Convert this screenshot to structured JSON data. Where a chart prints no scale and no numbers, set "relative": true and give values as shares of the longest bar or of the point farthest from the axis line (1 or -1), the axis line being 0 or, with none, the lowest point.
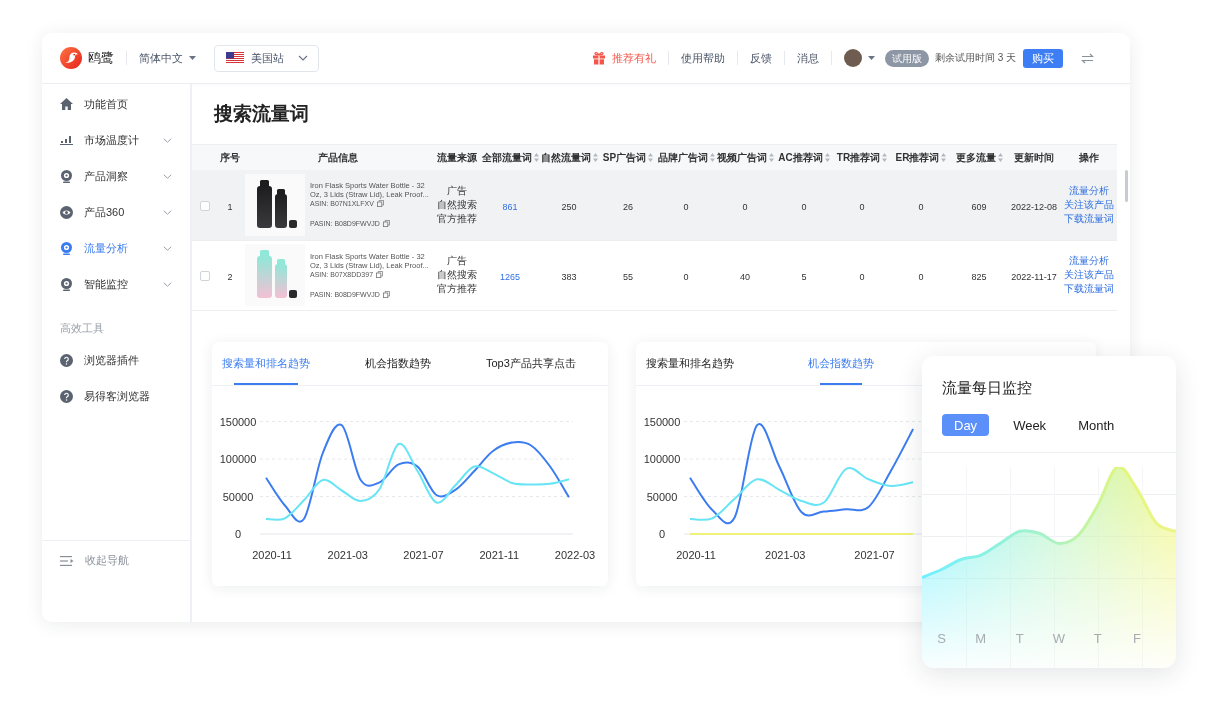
{
  "header": {
    "logo_text": "鸥鹭",
    "language": "简体中文",
    "region": "美国站",
    "links": [
      {
        "label": "推荐有礼",
        "kind": "promo"
      },
      {
        "label": "使用帮助",
        "kind": "plain"
      },
      {
        "label": "反馈",
        "kind": "plain"
      },
      {
        "label": "消息",
        "kind": "plain"
      }
    ],
    "plan_badge": "试用版",
    "trial_text": "剩余试用时间 3 天",
    "buy_button": "购买"
  },
  "sidebar": {
    "items": [
      {
        "label": "功能首页",
        "expandable": false,
        "selected": false
      },
      {
        "label": "市场温度计",
        "expandable": true,
        "selected": false
      },
      {
        "label": "产品洞察",
        "expandable": true,
        "selected": false
      },
      {
        "label": "产品360",
        "expandable": true,
        "selected": false
      },
      {
        "label": "流量分析",
        "expandable": true,
        "selected": true
      },
      {
        "label": "智能监控",
        "expandable": true,
        "selected": false
      }
    ],
    "section_title": "高效工具",
    "tools": [
      "浏览器插件",
      "易得客浏览器"
    ],
    "collapse_label": "收起导航"
  },
  "page_title": "搜索流量词",
  "table": {
    "columns": [
      {
        "label": "序号",
        "kind": "index",
        "sortable": false
      },
      {
        "label": "产品信息",
        "kind": "product",
        "sortable": false
      },
      {
        "label": "流量来源",
        "kind": "sources",
        "sortable": false
      },
      {
        "label": "全部流量词",
        "kind": "link",
        "sortable": true
      },
      {
        "label": "自然流量词",
        "kind": "number",
        "sortable": true
      },
      {
        "label": "SP广告词",
        "kind": "number",
        "sortable": true
      },
      {
        "label": "品牌广告词",
        "kind": "number",
        "sortable": true
      },
      {
        "label": "视频广告词",
        "kind": "number",
        "sortable": true
      },
      {
        "label": "AC推荐词",
        "kind": "number",
        "sortable": true
      },
      {
        "label": "TR推荐词",
        "kind": "number",
        "sortable": true
      },
      {
        "label": "ER推荐词",
        "kind": "number",
        "sortable": true
      },
      {
        "label": "更多流量",
        "kind": "number",
        "sortable": true
      },
      {
        "label": "更新时间",
        "kind": "date",
        "sortable": false
      },
      {
        "label": "操作",
        "kind": "actions",
        "sortable": false
      }
    ],
    "rows": [
      {
        "checked": false,
        "highlighted": true,
        "index": "1",
        "product": {
          "title": "Iron Flask Sports Water Bottle - 32 Oz, 3 Lids (Straw Lid), Leak Proof...",
          "asin": "ASIN: B07N1XLFXV",
          "pasin": "PASIN: B08D9FWVJD"
        },
        "sources": [
          "广告",
          "自然搜索",
          "官方推荐"
        ],
        "values": [
          "861",
          "250",
          "26",
          "0",
          "0",
          "0",
          "0",
          "0",
          "609"
        ],
        "updated": "2022-12-08",
        "actions": [
          "流量分析",
          "关注该产品",
          "下载流量词"
        ]
      },
      {
        "checked": false,
        "highlighted": false,
        "index": "2",
        "product": {
          "title": "Iron Flask Sports Water Bottle - 32 Oz, 3 Lids (Straw Lid), Leak Proof...",
          "asin": "ASIN: B07X8DD397",
          "pasin": "PASIN: B08D9FWVJD"
        },
        "sources": [
          "广告",
          "自然搜索",
          "官方推荐"
        ],
        "values": [
          "1265",
          "383",
          "55",
          "0",
          "40",
          "5",
          "0",
          "0",
          "825"
        ],
        "updated": "2022-11-17",
        "actions": [
          "流量分析",
          "关注该产品",
          "下载流量词"
        ]
      }
    ]
  },
  "charts": [
    {
      "tabs": [
        {
          "label": "搜索量和排名趋势",
          "selected": true
        },
        {
          "label": "机会指数趋势",
          "selected": false
        },
        {
          "label": "Top3产品共享点击",
          "selected": false
        }
      ],
      "chart_data": {
        "type": "line",
        "categories": [
          "2020-11",
          null,
          null,
          null,
          "2021-03",
          null,
          null,
          null,
          "2021-07",
          null,
          null,
          null,
          "2021-11",
          null,
          null,
          null,
          "2022-03"
        ],
        "ylim": [
          0,
          150000
        ],
        "yticks": [
          0,
          50000,
          100000,
          150000
        ],
        "grid": true,
        "series": [
          {
            "color": "#3b7cf0",
            "values": [
              75000,
              38000,
              20000,
              108000,
              145000,
              72000,
              69000,
              93000,
              90000,
              52000,
              59000,
              84000,
              111000,
              122000,
              118000,
              90000,
              49000
            ]
          },
          {
            "color": "#67e4f5",
            "values": [
              20000,
              21000,
              45000,
              72000,
              58000,
              44000,
              60000,
              120000,
              84000,
              42000,
              65000,
              90000,
              81000,
              68000,
              66000,
              67000,
              73000
            ]
          }
        ]
      }
    },
    {
      "tabs": [
        {
          "label": "搜索量和排名趋势",
          "selected": false
        },
        {
          "label": "机会指数趋势",
          "selected": true
        }
      ],
      "chart_data": {
        "type": "line",
        "categories": [
          "2020-11",
          null,
          null,
          null,
          "2021-03",
          null,
          null,
          null,
          "2021-07",
          null,
          null
        ],
        "ylim": [
          0,
          150000
        ],
        "yticks": [
          0,
          50000,
          100000,
          150000
        ],
        "grid": true,
        "series": [
          {
            "color": "#3b7cf0",
            "values": [
              75000,
              32000,
              22000,
              145000,
              90000,
              29000,
              30000,
              33000,
              36000,
              84000,
              140000
            ]
          },
          {
            "color": "#67e4f5",
            "values": [
              20000,
              21000,
              47000,
              73000,
              59000,
              44000,
              42000,
              87000,
              73000,
              64000,
              69000
            ]
          },
          {
            "color": "#eef27a",
            "values": [
              0,
              0,
              0,
              0,
              0,
              0,
              0,
              0,
              0,
              0,
              0
            ]
          }
        ]
      }
    }
  ],
  "monitor_card": {
    "title": "流量每日监控",
    "tabs": [
      {
        "label": "Day",
        "selected": true
      },
      {
        "label": "Week",
        "selected": false
      },
      {
        "label": "Month",
        "selected": false
      }
    ],
    "chart_data": {
      "type": "area",
      "relative": true,
      "grid": true,
      "categories": [
        null,
        "S",
        null,
        "M",
        null,
        "T",
        null,
        "W",
        null,
        "T",
        null,
        "F",
        null,
        null
      ],
      "series": [
        {
          "values": [
            0.45,
            0.49,
            0.54,
            0.56,
            0.62,
            0.68,
            0.67,
            0.62,
            0.66,
            0.81,
            1,
            0.89,
            0.72,
            0.68
          ]
        }
      ]
    }
  }
}
